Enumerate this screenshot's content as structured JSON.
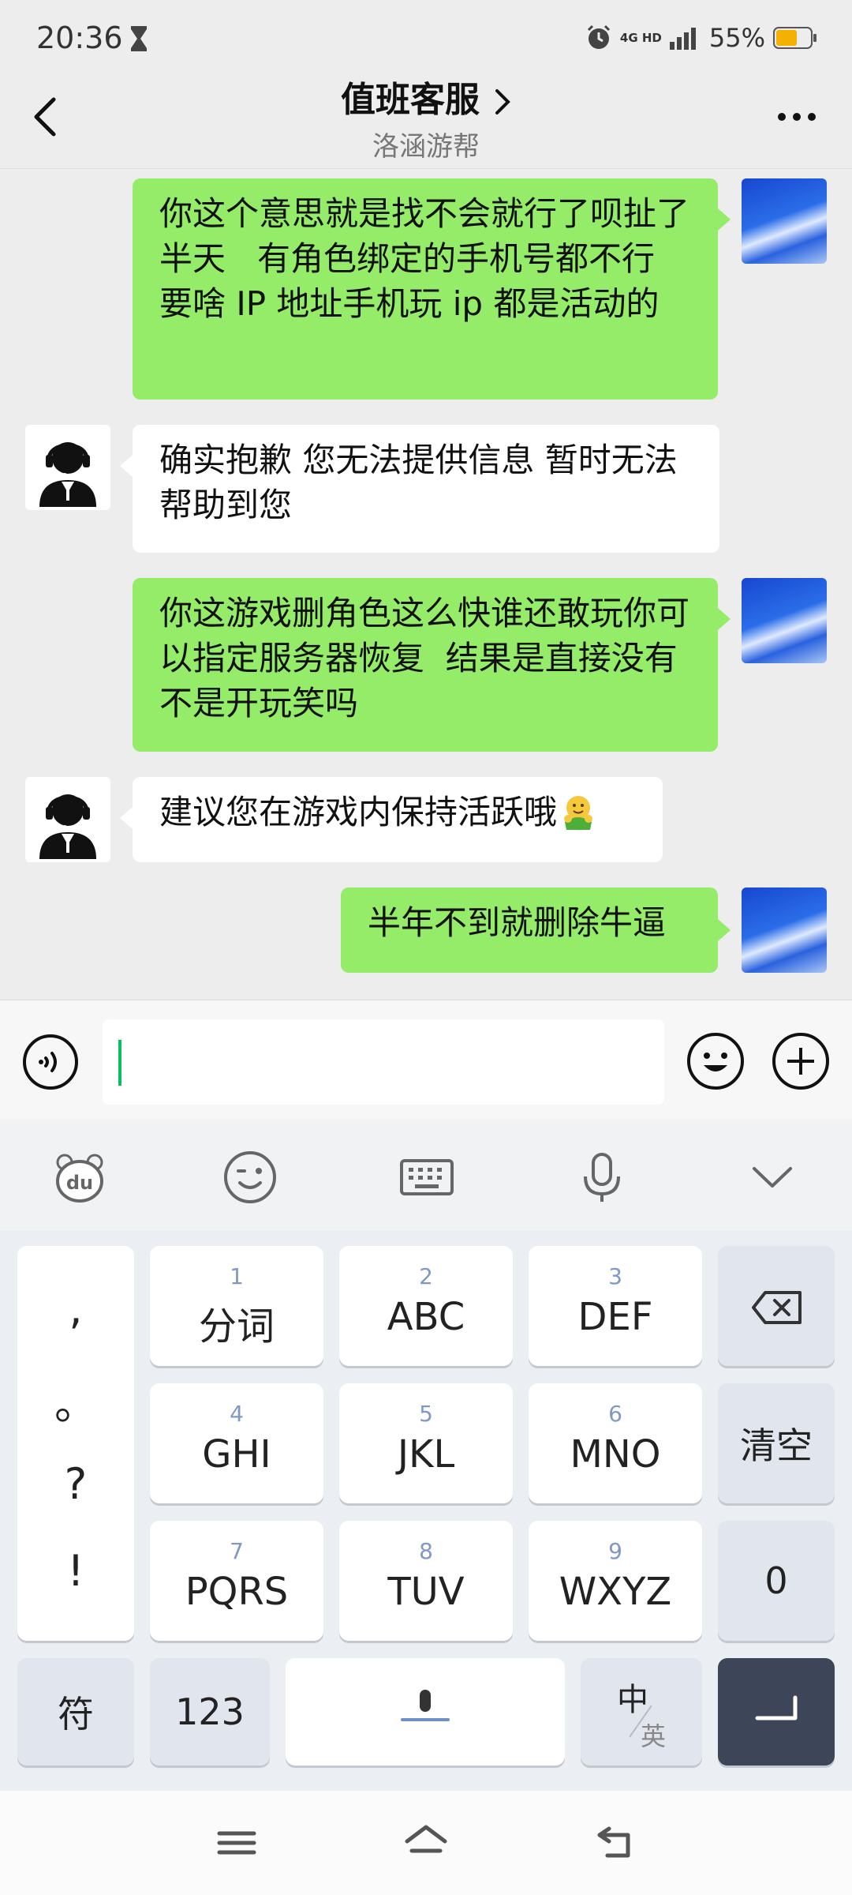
{
  "status_bar": {
    "time": "20:36",
    "network_top": "4G HD",
    "battery": "55%"
  },
  "header": {
    "title": "值班客服",
    "subtitle": "洛涵游帮"
  },
  "messages": [
    {
      "from": "me",
      "text": "你这个意思就是找不会就行了呗扯了半天   有角色绑定的手机号都不行   要啥 IP 地址手机玩 ip 都是活动的"
    },
    {
      "from": "agent",
      "text": "确实抱歉 您无法提供信息 暂时无法帮助到您"
    },
    {
      "from": "me",
      "text": "你这游戏删角色这么快谁还敢玩你可以指定服务器恢复  结果是直接没有不是开玩笑吗"
    },
    {
      "from": "agent",
      "text": "建议您在游戏内保持活跃哦",
      "emoji": "hug-emoji"
    },
    {
      "from": "me",
      "text": "半年不到就删除牛逼"
    }
  ],
  "input": {
    "value": ""
  },
  "keyboard": {
    "punct": [
      ",",
      "。",
      "?",
      "!"
    ],
    "keys": [
      {
        "num": "1",
        "label": "分词"
      },
      {
        "num": "2",
        "label": "ABC"
      },
      {
        "num": "3",
        "label": "DEF"
      },
      {
        "num": "4",
        "label": "GHI"
      },
      {
        "num": "5",
        "label": "JKL"
      },
      {
        "num": "6",
        "label": "MNO"
      },
      {
        "num": "7",
        "label": "PQRS"
      },
      {
        "num": "8",
        "label": "TUV"
      },
      {
        "num": "9",
        "label": "WXYZ"
      }
    ],
    "clear": "清空",
    "zero": "0",
    "symbols": "符",
    "numbers": "123",
    "lang_top": "中",
    "lang_bottom": "英"
  },
  "colors": {
    "outgoing_bubble": "#95ec69",
    "incoming_bubble": "#ffffff",
    "accent": "#07c160",
    "enter_key": "#3d4558"
  }
}
